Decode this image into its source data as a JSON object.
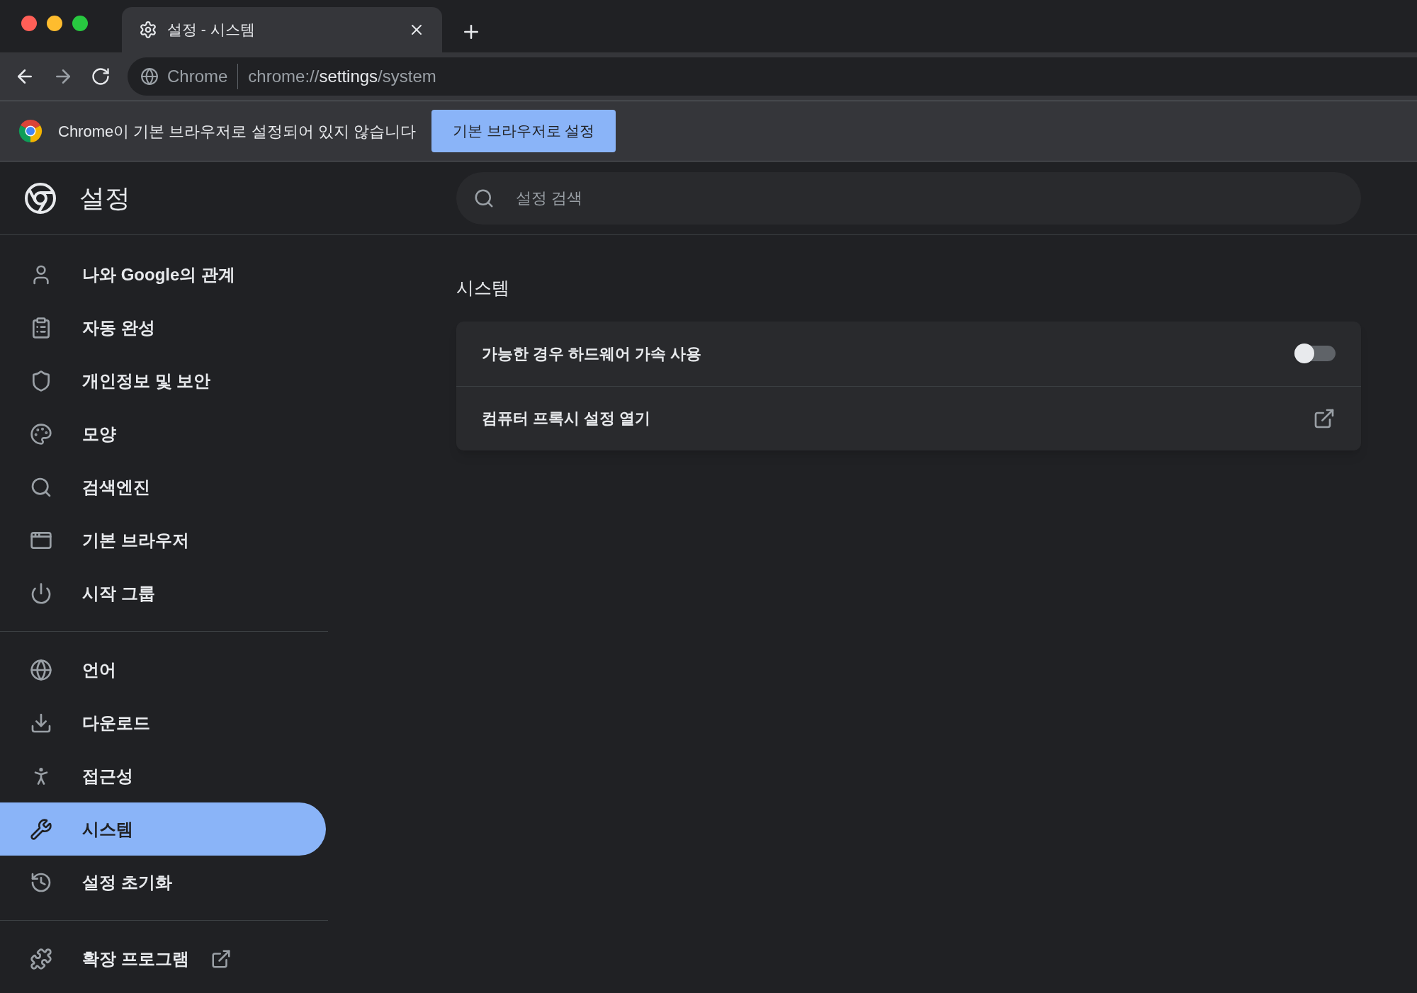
{
  "tab": {
    "title": "설정 - 시스템",
    "selected": true
  },
  "address": {
    "site_label": "Chrome",
    "url_scheme": "chrome://",
    "url_host": "settings",
    "url_path": "/system"
  },
  "infobar": {
    "message": "Chrome이 기본 브라우저로 설정되어 있지 않습니다",
    "button": "기본 브라우저로 설정"
  },
  "settings": {
    "title": "설정",
    "search": {
      "placeholder": "설정 검색"
    }
  },
  "sidebar": {
    "sections": [
      {
        "items": [
          {
            "label": "나와 Google의 관계",
            "selected": false
          },
          {
            "label": "자동 완성",
            "selected": false
          },
          {
            "label": "개인정보 및 보안",
            "selected": false
          },
          {
            "label": "모양",
            "selected": false
          },
          {
            "label": "검색엔진",
            "selected": false
          },
          {
            "label": "기본 브라우저",
            "selected": false
          },
          {
            "label": "시작 그룹",
            "selected": false
          }
        ]
      },
      {
        "items": [
          {
            "label": "언어",
            "selected": false
          },
          {
            "label": "다운로드",
            "selected": false
          },
          {
            "label": "접근성",
            "selected": false
          },
          {
            "label": "시스템",
            "selected": true
          },
          {
            "label": "설정 초기화",
            "selected": false
          }
        ]
      },
      {
        "items": [
          {
            "label": "확장 프로그램",
            "selected": false,
            "external": true
          }
        ]
      }
    ]
  },
  "content": {
    "section_title": "시스템",
    "rows": [
      {
        "kind": "toggle",
        "label": "가능한 경우 하드웨어 가속 사용",
        "on": false
      },
      {
        "kind": "link",
        "label": "컴퓨터 프록시 설정 열기"
      }
    ]
  }
}
